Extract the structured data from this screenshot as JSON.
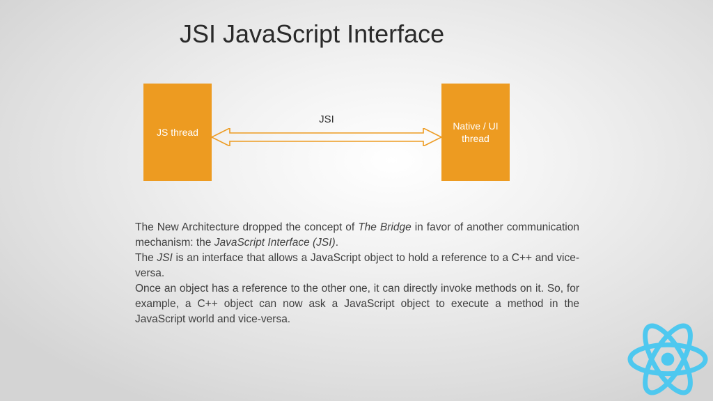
{
  "title": "JSI JavaScript Interface",
  "diagram": {
    "left_box": "JS thread",
    "right_box": "Native / UI thread",
    "arrow_label": "JSI"
  },
  "paragraphs": {
    "p1_a": "The New Architecture dropped the concept of ",
    "p1_em1": "The Bridge",
    "p1_b": " in favor of another communication mechanism: the ",
    "p1_em2": "JavaScript Interface (JSI)",
    "p1_c": ".",
    "p2_a": "The ",
    "p2_em1": "JSI",
    "p2_b": " is an interface that allows a JavaScript object to hold a reference to a C++ and vice-versa.",
    "p3": "Once an object has a reference to the other one, it can directly invoke methods on it. So, for example, a C++ object can now ask a JavaScript object to execute a method in the JavaScript world and vice-versa."
  },
  "colors": {
    "accent": "#ed9b21",
    "logo": "#4ec8ef"
  },
  "logo_name": "react-logo"
}
